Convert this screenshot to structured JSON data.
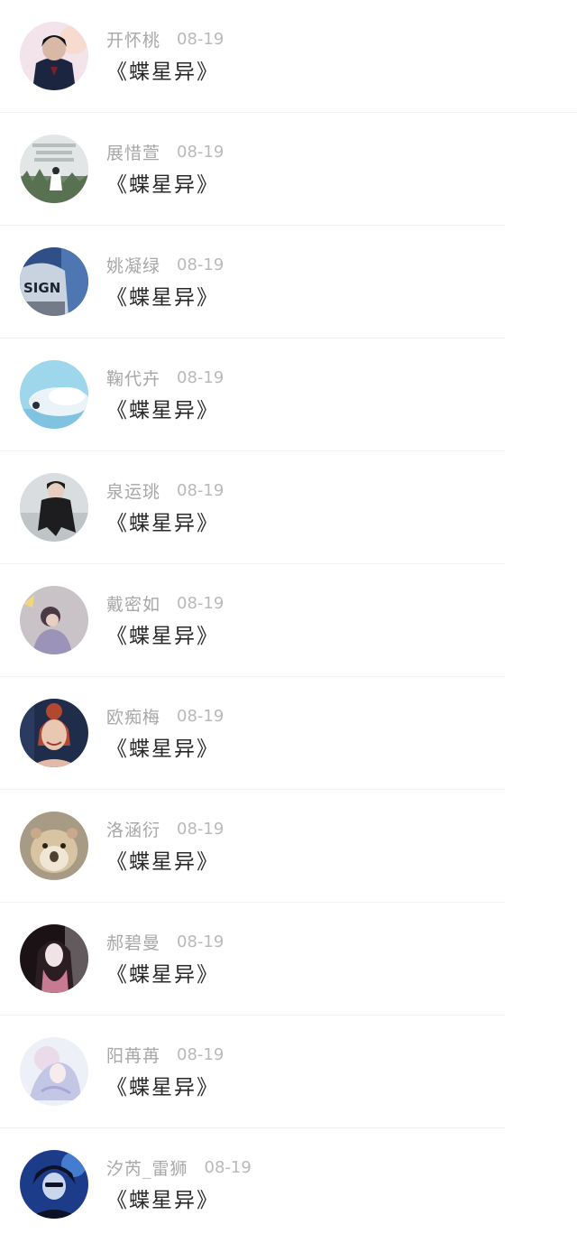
{
  "messages": [
    {
      "name": "开怀桃",
      "date": "08-19",
      "text": "《蝶星异》",
      "avatar_icon": "anime-boy-avatar-icon",
      "avatar_colors": [
        "#f3e3ea",
        "#1c2540",
        "#d9b8a5"
      ]
    },
    {
      "name": "展惜萱",
      "date": "08-19",
      "text": "《蝶星异》",
      "avatar_icon": "girl-in-field-avatar-icon",
      "avatar_colors": [
        "#e2e6e6",
        "#6f8a6a",
        "#ffffff"
      ]
    },
    {
      "name": "姚凝绿",
      "date": "08-19",
      "text": "《蝶星异》",
      "avatar_icon": "sign-shirt-avatar-icon",
      "avatar_colors": [
        "#2f4f86",
        "#c9d3df",
        "#1b2330"
      ]
    },
    {
      "name": "鞠代卉",
      "date": "08-19",
      "text": "《蝶星异》",
      "avatar_icon": "seal-avatar-icon",
      "avatar_colors": [
        "#9ed6ec",
        "#eaf3f8",
        "#2a2f36"
      ]
    },
    {
      "name": "泉运珧",
      "date": "08-19",
      "text": "《蝶星异》",
      "avatar_icon": "person-black-coat-avatar-icon",
      "avatar_colors": [
        "#d9dde0",
        "#1d1d1f",
        "#bfc4c7"
      ]
    },
    {
      "name": "戴密如",
      "date": "08-19",
      "text": "《蝶星异》",
      "avatar_icon": "girl-sitting-avatar-icon",
      "avatar_colors": [
        "#c9c3c7",
        "#4a3a44",
        "#9c94b8"
      ]
    },
    {
      "name": "欧痴梅",
      "date": "08-19",
      "text": "《蝶星异》",
      "avatar_icon": "smiling-girl-avatar-icon",
      "avatar_colors": [
        "#1f2c4a",
        "#e9c7b2",
        "#b0492f"
      ]
    },
    {
      "name": "洛涵衍",
      "date": "08-19",
      "text": "《蝶星异》",
      "avatar_icon": "hamster-avatar-icon",
      "avatar_colors": [
        "#a89b86",
        "#d8c3a3",
        "#4e4131"
      ]
    },
    {
      "name": "郝碧曼",
      "date": "08-19",
      "text": "《蝶星异》",
      "avatar_icon": "dark-hair-girl-avatar-icon",
      "avatar_colors": [
        "#1a1214",
        "#c87a92",
        "#efe3e6"
      ]
    },
    {
      "name": "阳苒苒",
      "date": "08-19",
      "text": "《蝶星异》",
      "avatar_icon": "pastel-anime-avatar-icon",
      "avatar_colors": [
        "#eef0f8",
        "#c4c6e6",
        "#e8d4e6"
      ]
    },
    {
      "name": "汐芮_雷狮",
      "date": "08-19",
      "text": "《蝶星异》",
      "avatar_icon": "anime-blue-boy-avatar-icon",
      "avatar_colors": [
        "#1c3c8a",
        "#0d1226",
        "#5fa6ff"
      ]
    }
  ]
}
